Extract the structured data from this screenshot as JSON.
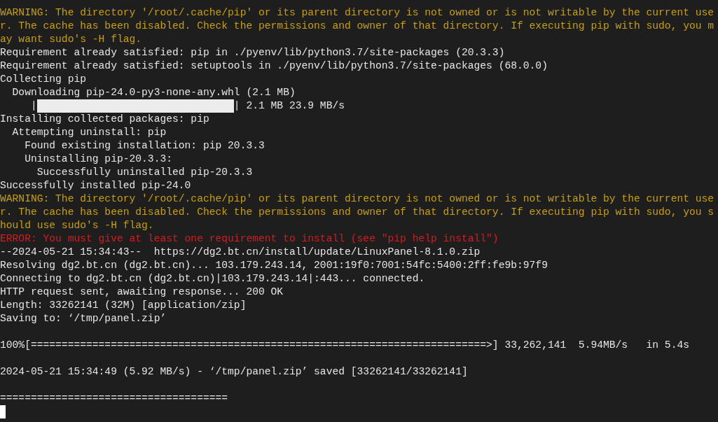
{
  "terminal": {
    "lines": [
      {
        "kind": "warning",
        "text": "WARNING: The directory '/root/.cache/pip' or its parent directory is not owned or is not writable by the current use"
      },
      {
        "kind": "warning",
        "text": "r. The cache has been disabled. Check the permissions and owner of that directory. If executing pip with sudo, you m"
      },
      {
        "kind": "warning",
        "text": "ay want sudo's -H flag."
      },
      {
        "kind": "normal",
        "text": "Requirement already satisfied: pip in ./pyenv/lib/python3.7/site-packages (20.3.3)"
      },
      {
        "kind": "normal",
        "text": "Requirement already satisfied: setuptools in ./pyenv/lib/python3.7/site-packages (68.0.0)"
      },
      {
        "kind": "normal",
        "text": "Collecting pip"
      },
      {
        "kind": "normal",
        "text": "  Downloading pip-24.0-py3-none-any.whl (2.1 MB)"
      },
      {
        "kind": "progress",
        "lead": "     |",
        "level": 1,
        "reading": "| 2.1 MB 23.9 MB/s"
      },
      {
        "kind": "normal",
        "text": "Installing collected packages: pip"
      },
      {
        "kind": "normal",
        "text": "  Attempting uninstall: pip"
      },
      {
        "kind": "normal",
        "text": "    Found existing installation: pip 20.3.3"
      },
      {
        "kind": "normal",
        "text": "    Uninstalling pip-20.3.3:"
      },
      {
        "kind": "normal",
        "text": "      Successfully uninstalled pip-20.3.3"
      },
      {
        "kind": "normal",
        "text": "Successfully installed pip-24.0"
      },
      {
        "kind": "warning",
        "text": "WARNING: The directory '/root/.cache/pip' or its parent directory is not owned or is not writable by the current use"
      },
      {
        "kind": "warning",
        "text": "r. The cache has been disabled. Check the permissions and owner of that directory. If executing pip with sudo, you s"
      },
      {
        "kind": "warning",
        "text": "hould use sudo's -H flag."
      },
      {
        "kind": "error",
        "text": "ERROR: You must give at least one requirement to install (see \"pip help install\")"
      },
      {
        "kind": "normal",
        "text": "--2024-05-21 15:34:43--  https://dg2.bt.cn/install/update/LinuxPanel-8.1.0.zip"
      },
      {
        "kind": "normal",
        "text": "Resolving dg2.bt.cn (dg2.bt.cn)... 103.179.243.14, 2001:19f0:7001:54fc:5400:2ff:fe9b:97f9"
      },
      {
        "kind": "normal",
        "text": "Connecting to dg2.bt.cn (dg2.bt.cn)|103.179.243.14|:443... connected."
      },
      {
        "kind": "normal",
        "text": "HTTP request sent, awaiting response... 200 OK"
      },
      {
        "kind": "normal",
        "text": "Length: 33262141 (32M) [application/zip]"
      },
      {
        "kind": "normal",
        "text": "Saving to: ‘/tmp/panel.zip’"
      },
      {
        "kind": "blank"
      },
      {
        "kind": "normal",
        "text": "100%[==========================================================================>] 33,262,141  5.94MB/s   in 5.4s"
      },
      {
        "kind": "blank"
      },
      {
        "kind": "normal",
        "text": "2024-05-21 15:34:49 (5.92 MB/s) - ‘/tmp/panel.zip’ saved [33262141/33262141]"
      },
      {
        "kind": "blank"
      },
      {
        "kind": "normal",
        "text": "====================================="
      },
      {
        "kind": "cursor"
      }
    ]
  }
}
